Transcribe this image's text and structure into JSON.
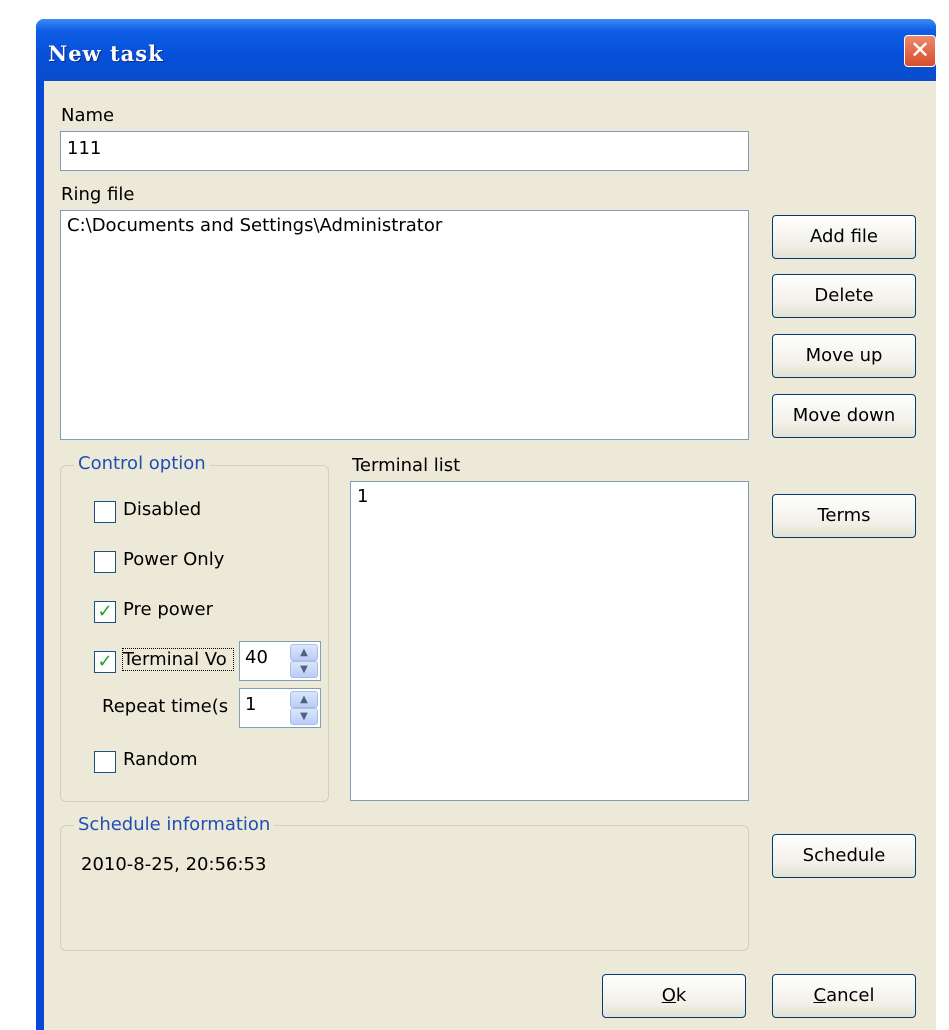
{
  "window": {
    "title": "New task",
    "close_glyph": "✕"
  },
  "name": {
    "label": "Name",
    "value": "111"
  },
  "ring": {
    "label": "Ring file",
    "files": [
      "C:\\Documents and Settings\\Administrator"
    ],
    "buttons": {
      "add": "Add file",
      "delete": "Delete",
      "move_up": "Move up",
      "move_down": "Move down"
    }
  },
  "control": {
    "caption": "Control option",
    "disabled": {
      "label": "Disabled",
      "checked": false
    },
    "power_only": {
      "label": "Power Only",
      "checked": false
    },
    "pre_power": {
      "label": "Pre power",
      "checked": true
    },
    "terminal_vol": {
      "label": "Terminal Vo",
      "checked": true,
      "value": "40"
    },
    "repeat": {
      "label": "Repeat time(s",
      "value": "1"
    },
    "random": {
      "label": "Random",
      "checked": false
    },
    "check_glyph": "✓"
  },
  "terminal": {
    "label": "Terminal list",
    "items": [
      "1"
    ],
    "button": "Terms"
  },
  "schedule": {
    "caption": "Schedule information",
    "value": "2010-8-25, 20:56:53",
    "button": "Schedule"
  },
  "footer": {
    "ok_mnemonic": "O",
    "ok_rest": "k",
    "cancel_mnemonic": "C",
    "cancel_rest": "ancel"
  },
  "icons": {
    "spin_up": "▲",
    "spin_down": "▼"
  },
  "colors": {
    "titlebar": "#0750da",
    "dialog_bg": "#ece9d8",
    "group_caption": "#1f4fb3",
    "check": "#21a121"
  }
}
